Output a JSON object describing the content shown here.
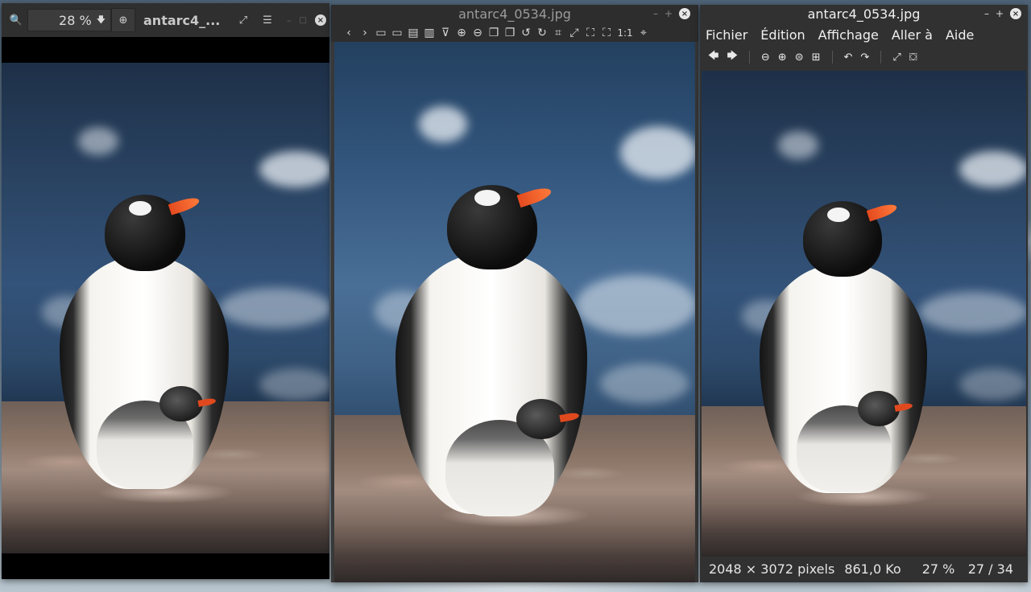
{
  "viewer1": {
    "title": "antarc4_...",
    "zoom": "28 %",
    "zoom_out_icon": "zoom-out-icon",
    "zoom_in_icon": "zoom-in-icon",
    "fullscreen_icon": "fullscreen-icon",
    "menu_icon": "hamburger-menu-icon",
    "minimize_symbol": "–",
    "maximize_symbol": "□",
    "close_symbol": "×"
  },
  "viewer2": {
    "title": "antarc4_0534.jpg",
    "minimize_symbol": "–",
    "maximize_symbol": "+",
    "close_symbol": "×",
    "toolbar": [
      "‹",
      "›",
      "▭",
      "▭",
      "▤",
      "▥",
      "⊽",
      "⊕",
      "⊖",
      "❐",
      "❐",
      "↺",
      "↻",
      "⌗",
      "⤢",
      "⛶",
      "⛶",
      "1:1",
      "⌖"
    ]
  },
  "viewer3": {
    "title": "antarc4_0534.jpg",
    "minimize_symbol": "–",
    "maximize_symbol": "+",
    "close_symbol": "×",
    "menu": [
      "Fichier",
      "Édition",
      "Affichage",
      "Aller à",
      "Aide"
    ],
    "toolbar": {
      "back": "🡄",
      "forward": "🡆",
      "zoom_out": "⊖",
      "zoom_in": "⊕",
      "zoom_fit": "⊜",
      "zoom_orig": "⊞",
      "rotate_left": "↶",
      "rotate_right": "↷",
      "fullscreen": "⤢",
      "slideshow": "⛋"
    },
    "status": {
      "dimensions": "2048 × 3072 pixels",
      "size": "861,0 Ko",
      "zoom": "27 %",
      "position": "27 / 34"
    }
  }
}
